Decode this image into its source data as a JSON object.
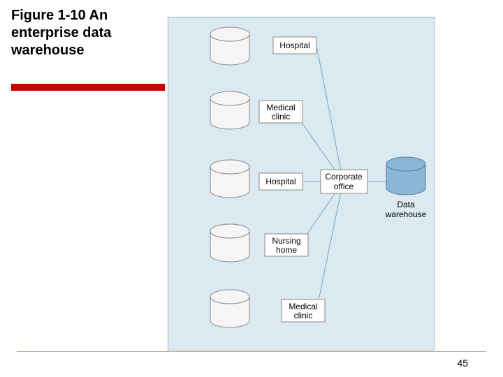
{
  "title": "Figure 1-10 An enterprise data warehouse",
  "page_number": "45",
  "diagram": {
    "sources": [
      {
        "label": "Hospital"
      },
      {
        "label": "Medical clinic"
      },
      {
        "label": "Hospital"
      },
      {
        "label": "Nursing home"
      },
      {
        "label": "Medical clinic"
      }
    ],
    "hub": {
      "label": "Corporate office"
    },
    "warehouse": {
      "label": "Data warehouse"
    }
  }
}
